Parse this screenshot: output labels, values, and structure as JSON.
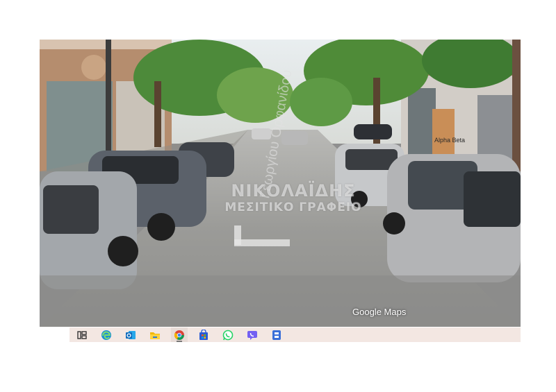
{
  "street_view": {
    "street_label": "Γεωργίου Ορφανίδου",
    "watermark_line1": "ΝΙΚΟΛΑΪΔΗΣ",
    "watermark_line2": "ΜΕΣΙΤΙΚΟ ΓΡΑΦΕΙΟ",
    "attribution": "Google Maps",
    "shop_sign": "Alpha Beta"
  },
  "taskbar": {
    "apps": [
      {
        "name": "task-view",
        "icon": "task-view-icon",
        "color": "#333333"
      },
      {
        "name": "edge",
        "icon": "edge-icon",
        "color": "#1a8fd6"
      },
      {
        "name": "outlook",
        "icon": "outlook-icon",
        "color": "#0f6cbd"
      },
      {
        "name": "file-explorer",
        "icon": "folder-icon",
        "color": "#f2b800"
      },
      {
        "name": "chrome",
        "icon": "chrome-icon",
        "color": "#db4437",
        "active": true
      },
      {
        "name": "store",
        "icon": "store-icon",
        "color": "#2a5bd7"
      },
      {
        "name": "whatsapp",
        "icon": "whatsapp-icon",
        "color": "#25d366"
      },
      {
        "name": "viber",
        "icon": "viber-icon",
        "color": "#7360f2"
      },
      {
        "name": "unknown-app",
        "icon": "app-icon",
        "color": "#3a6fd8"
      }
    ]
  }
}
